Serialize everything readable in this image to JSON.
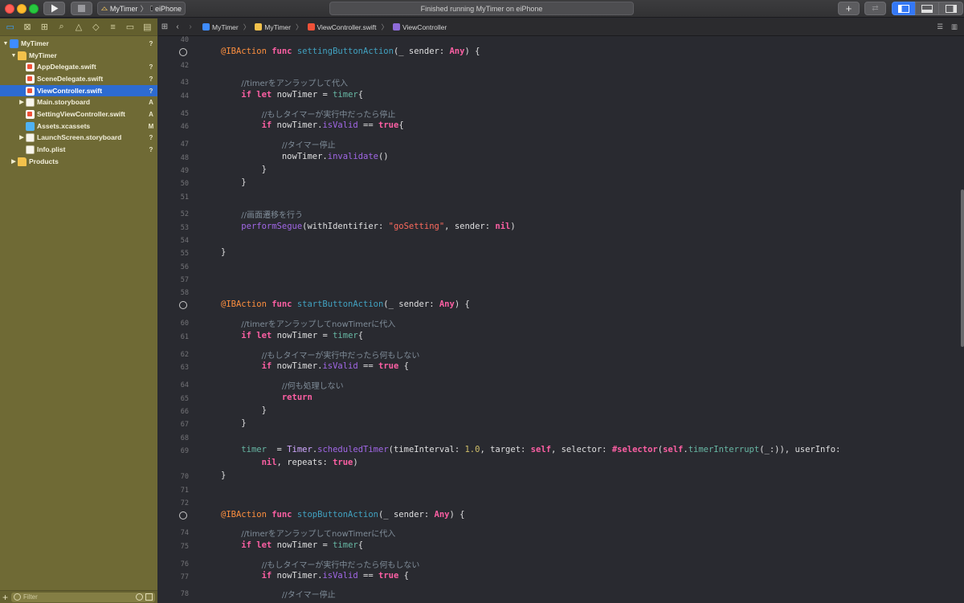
{
  "toolbar": {
    "scheme_name": "MyTimer",
    "device_name": "eiPhone",
    "status": "Finished running MyTimer on eiPhone"
  },
  "navigator": {
    "filter_placeholder": "Filter",
    "tree": [
      {
        "label": "MyTimer",
        "status": "?",
        "kind": "project",
        "indent": 0,
        "disclosure": "open"
      },
      {
        "label": "MyTimer",
        "status": "",
        "kind": "folder",
        "indent": 1,
        "disclosure": "open"
      },
      {
        "label": "AppDelegate.swift",
        "status": "?",
        "kind": "swift",
        "indent": 2,
        "disclosure": ""
      },
      {
        "label": "SceneDelegate.swift",
        "status": "?",
        "kind": "swift",
        "indent": 2,
        "disclosure": ""
      },
      {
        "label": "ViewController.swift",
        "status": "?",
        "kind": "swift",
        "indent": 2,
        "disclosure": "",
        "selected": true
      },
      {
        "label": "Main.storyboard",
        "status": "A",
        "kind": "storyboard",
        "indent": 2,
        "disclosure": "closed"
      },
      {
        "label": "SettingViewController.swift",
        "status": "A",
        "kind": "swift",
        "indent": 2,
        "disclosure": ""
      },
      {
        "label": "Assets.xcassets",
        "status": "M",
        "kind": "assets",
        "indent": 2,
        "disclosure": ""
      },
      {
        "label": "LaunchScreen.storyboard",
        "status": "?",
        "kind": "storyboard",
        "indent": 2,
        "disclosure": "closed"
      },
      {
        "label": "Info.plist",
        "status": "?",
        "kind": "plist",
        "indent": 2,
        "disclosure": ""
      },
      {
        "label": "Products",
        "status": "",
        "kind": "folder",
        "indent": 1,
        "disclosure": "closed"
      }
    ]
  },
  "jumpbar": {
    "crumbs": [
      "MyTimer",
      "MyTimer",
      "ViewController.swift",
      "ViewController"
    ]
  },
  "editor": {
    "lines": [
      {
        "n": "40",
        "segs": []
      },
      {
        "n": "",
        "bp": true,
        "segs": [
          [
            "attr",
            "@IBAction "
          ],
          [
            "kw",
            "func "
          ],
          [
            "fnname",
            "settingButtonAction"
          ],
          [
            "plain",
            "(_ sender: "
          ],
          [
            "kw",
            "Any"
          ],
          [
            "plain",
            ") {"
          ]
        ]
      },
      {
        "n": "42",
        "segs": []
      },
      {
        "n": "43",
        "segs": [
          [
            "plain",
            "    "
          ],
          [
            "cmt",
            "//timerをアンラップして代入"
          ]
        ]
      },
      {
        "n": "44",
        "segs": [
          [
            "plain",
            "    "
          ],
          [
            "kw",
            "if let "
          ],
          [
            "plain",
            "nowTimer = "
          ],
          [
            "id",
            "timer"
          ],
          [
            "plain",
            "{"
          ]
        ]
      },
      {
        "n": "45",
        "segs": [
          [
            "plain",
            "        "
          ],
          [
            "cmt",
            "//もしタイマーが実行中だったら停止"
          ]
        ]
      },
      {
        "n": "46",
        "segs": [
          [
            "plain",
            "        "
          ],
          [
            "kw",
            "if "
          ],
          [
            "plain",
            "nowTimer."
          ],
          [
            "prop",
            "isValid"
          ],
          [
            "plain",
            " == "
          ],
          [
            "kw",
            "true"
          ],
          [
            "plain",
            "{"
          ]
        ]
      },
      {
        "n": "47",
        "segs": [
          [
            "plain",
            "            "
          ],
          [
            "cmt",
            "//タイマー停止"
          ]
        ]
      },
      {
        "n": "48",
        "segs": [
          [
            "plain",
            "            nowTimer."
          ],
          [
            "prop",
            "invalidate"
          ],
          [
            "plain",
            "()"
          ]
        ]
      },
      {
        "n": "49",
        "segs": [
          [
            "plain",
            "        }"
          ]
        ]
      },
      {
        "n": "50",
        "segs": [
          [
            "plain",
            "    }"
          ]
        ]
      },
      {
        "n": "51",
        "segs": []
      },
      {
        "n": "52",
        "segs": [
          [
            "plain",
            "    "
          ],
          [
            "cmt",
            "//画面遷移を行う"
          ]
        ]
      },
      {
        "n": "53",
        "segs": [
          [
            "plain",
            "    "
          ],
          [
            "prop",
            "performSegue"
          ],
          [
            "plain",
            "(withIdentifier: "
          ],
          [
            "str",
            "\"goSetting\""
          ],
          [
            "plain",
            ", sender: "
          ],
          [
            "kw",
            "nil"
          ],
          [
            "plain",
            ")"
          ]
        ]
      },
      {
        "n": "54",
        "segs": []
      },
      {
        "n": "55",
        "segs": [
          [
            "plain",
            "}"
          ]
        ]
      },
      {
        "n": "56",
        "segs": []
      },
      {
        "n": "57",
        "segs": []
      },
      {
        "n": "58",
        "segs": []
      },
      {
        "n": "",
        "bp": true,
        "segs": [
          [
            "attr",
            "@IBAction "
          ],
          [
            "kw",
            "func "
          ],
          [
            "fnname",
            "startButtonAction"
          ],
          [
            "plain",
            "(_ sender: "
          ],
          [
            "kw",
            "Any"
          ],
          [
            "plain",
            ") {"
          ]
        ]
      },
      {
        "n": "60",
        "segs": [
          [
            "plain",
            "    "
          ],
          [
            "cmt",
            "//timerをアンラップしてnowTimerに代入"
          ]
        ]
      },
      {
        "n": "61",
        "segs": [
          [
            "plain",
            "    "
          ],
          [
            "kw",
            "if let "
          ],
          [
            "plain",
            "nowTimer = "
          ],
          [
            "id",
            "timer"
          ],
          [
            "plain",
            "{"
          ]
        ]
      },
      {
        "n": "62",
        "segs": [
          [
            "plain",
            "        "
          ],
          [
            "cmt",
            "//もしタイマーが実行中だったら何もしない"
          ]
        ]
      },
      {
        "n": "63",
        "segs": [
          [
            "plain",
            "        "
          ],
          [
            "kw",
            "if "
          ],
          [
            "plain",
            "nowTimer."
          ],
          [
            "prop",
            "isValid"
          ],
          [
            "plain",
            " == "
          ],
          [
            "kw",
            "true"
          ],
          [
            "plain",
            " {"
          ]
        ]
      },
      {
        "n": "64",
        "segs": [
          [
            "plain",
            "            "
          ],
          [
            "cmt",
            "//何も処理しない"
          ]
        ]
      },
      {
        "n": "65",
        "segs": [
          [
            "plain",
            "            "
          ],
          [
            "kw",
            "return"
          ]
        ]
      },
      {
        "n": "66",
        "segs": [
          [
            "plain",
            "        }"
          ]
        ]
      },
      {
        "n": "67",
        "segs": [
          [
            "plain",
            "    }"
          ]
        ]
      },
      {
        "n": "68",
        "segs": []
      },
      {
        "n": "69",
        "segs": [
          [
            "plain",
            "    "
          ],
          [
            "id",
            "timer"
          ],
          [
            "plain",
            "  = "
          ],
          [
            "type",
            "Timer"
          ],
          [
            "plain",
            "."
          ],
          [
            "prop",
            "scheduledTimer"
          ],
          [
            "plain",
            "(timeInterval: "
          ],
          [
            "num",
            "1.0"
          ],
          [
            "plain",
            ", target: "
          ],
          [
            "kw",
            "self"
          ],
          [
            "plain",
            ", selector: "
          ],
          [
            "kw",
            "#selector"
          ],
          [
            "plain",
            "("
          ],
          [
            "kw",
            "self"
          ],
          [
            "plain",
            "."
          ],
          [
            "id",
            "timerInterrupt"
          ],
          [
            "plain",
            "(_:)), userInfo:"
          ]
        ]
      },
      {
        "n": "",
        "segs": [
          [
            "plain",
            "        "
          ],
          [
            "kw",
            "nil"
          ],
          [
            "plain",
            ", repeats: "
          ],
          [
            "kw",
            "true"
          ],
          [
            "plain",
            ")"
          ]
        ]
      },
      {
        "n": "70",
        "segs": [
          [
            "plain",
            "}"
          ]
        ]
      },
      {
        "n": "71",
        "segs": []
      },
      {
        "n": "72",
        "segs": []
      },
      {
        "n": "",
        "bp": true,
        "segs": [
          [
            "attr",
            "@IBAction "
          ],
          [
            "kw",
            "func "
          ],
          [
            "fnname",
            "stopButtonAction"
          ],
          [
            "plain",
            "(_ sender: "
          ],
          [
            "kw",
            "Any"
          ],
          [
            "plain",
            ") {"
          ]
        ]
      },
      {
        "n": "74",
        "segs": [
          [
            "plain",
            "    "
          ],
          [
            "cmt",
            "//timerをアンラップしてnowTimerに代入"
          ]
        ]
      },
      {
        "n": "75",
        "segs": [
          [
            "plain",
            "    "
          ],
          [
            "kw",
            "if let "
          ],
          [
            "plain",
            "nowTimer = "
          ],
          [
            "id",
            "timer"
          ],
          [
            "plain",
            "{"
          ]
        ]
      },
      {
        "n": "76",
        "segs": [
          [
            "plain",
            "        "
          ],
          [
            "cmt",
            "//もしタイマーが実行中だったら何もしない"
          ]
        ]
      },
      {
        "n": "77",
        "segs": [
          [
            "plain",
            "        "
          ],
          [
            "kw",
            "if "
          ],
          [
            "plain",
            "nowTimer."
          ],
          [
            "prop",
            "isValid"
          ],
          [
            "plain",
            " == "
          ],
          [
            "kw",
            "true"
          ],
          [
            "plain",
            " {"
          ]
        ]
      },
      {
        "n": "78",
        "segs": [
          [
            "plain",
            "            "
          ],
          [
            "cmt",
            "//タイマー停止"
          ]
        ]
      }
    ]
  }
}
